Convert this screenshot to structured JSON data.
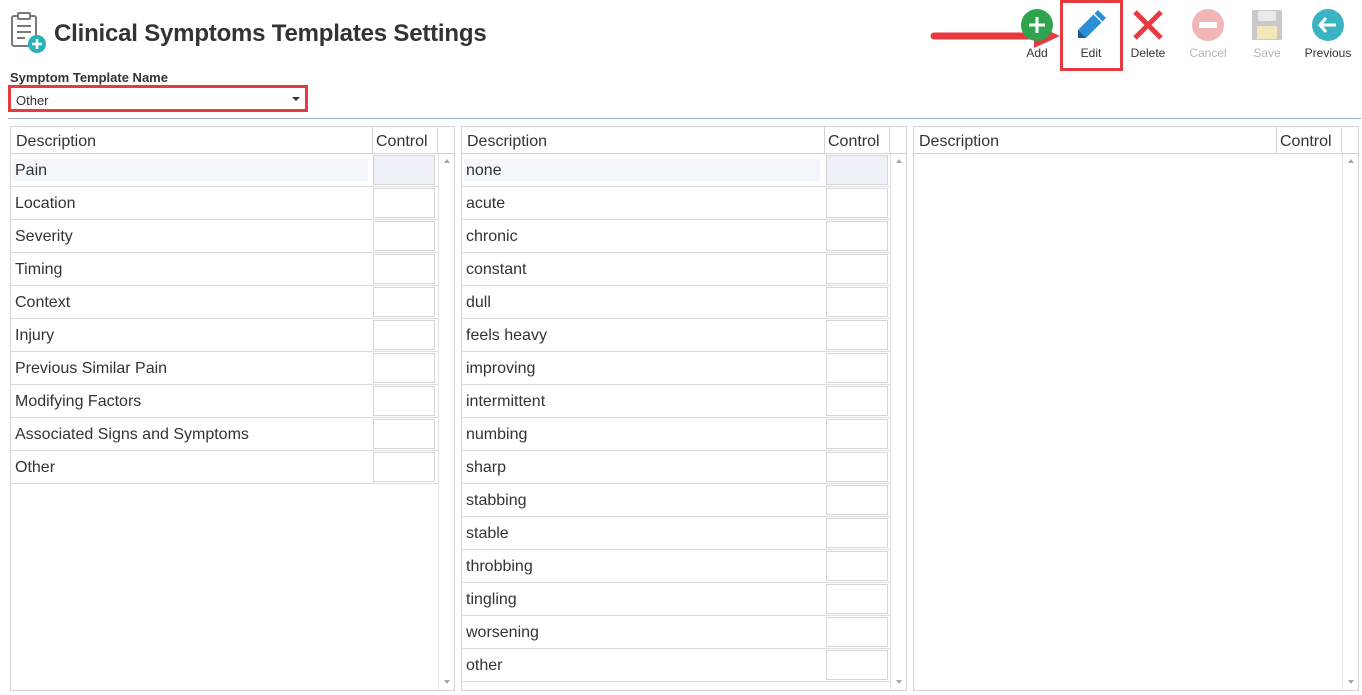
{
  "header": {
    "title": "Clinical Symptoms Templates Settings",
    "icon": "clipboard-add-icon"
  },
  "toolbar": {
    "add_label": "Add",
    "edit_label": "Edit",
    "delete_label": "Delete",
    "cancel_label": "Cancel",
    "save_label": "Save",
    "previous_label": "Previous"
  },
  "template": {
    "label": "Symptom Template Name",
    "selected": "Other"
  },
  "grid1": {
    "col_description": "Description",
    "col_control": "Control",
    "rows": [
      "Pain",
      "Location",
      "Severity",
      "Timing",
      "Context",
      "Injury",
      "Previous Similar Pain",
      "Modifying Factors",
      "Associated Signs and Symptoms",
      "Other"
    ]
  },
  "grid2": {
    "col_description": "Description",
    "col_control": "Control",
    "rows": [
      "none",
      "acute",
      "chronic",
      "constant",
      "dull",
      "feels heavy",
      "improving",
      "intermittent",
      "numbing",
      "sharp",
      "stabbing",
      "stable",
      "throbbing",
      "tingling",
      "worsening",
      "other"
    ]
  },
  "grid3": {
    "col_description": "Description",
    "col_control": "Control",
    "rows": []
  },
  "colors": {
    "highlight": "#e53a40",
    "add_green": "#2ea44f",
    "edit_blue": "#2c8fd6",
    "delete_red": "#e53a40",
    "previous_teal": "#3bb3c3",
    "divider": "#9aaac8"
  }
}
